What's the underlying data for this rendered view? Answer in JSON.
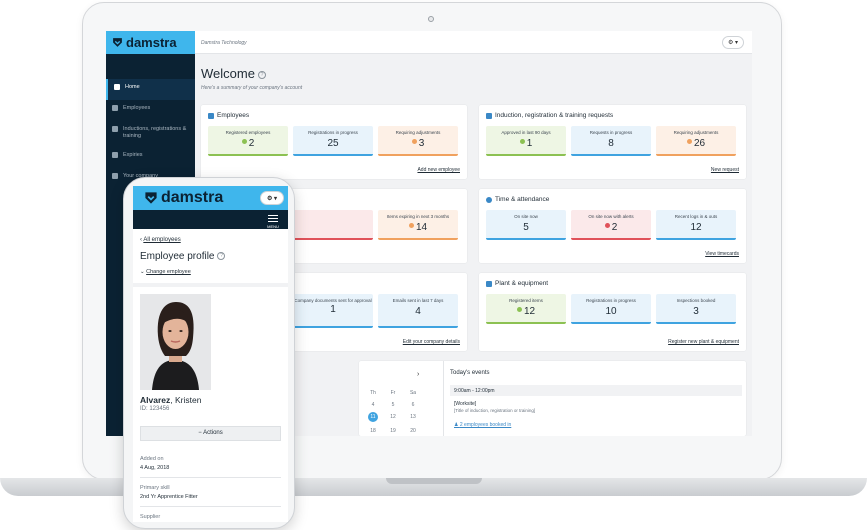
{
  "app": {
    "brand": "damstra",
    "org_name": "Damstra Technology",
    "settings_label": "⚙ ▾"
  },
  "sidebar": {
    "items": [
      {
        "label": "Home",
        "icon": "home-icon"
      },
      {
        "label": "Employees",
        "icon": "user-icon"
      },
      {
        "label": "Inductions, registrations & training",
        "icon": "clipboard-icon"
      },
      {
        "label": "Expiries",
        "icon": "calendar-icon"
      },
      {
        "label": "Your company",
        "icon": "group-icon"
      }
    ]
  },
  "main": {
    "welcome": "Welcome",
    "welcome_sub": "Here's a summary of your company's account",
    "employees": {
      "title": "Employees",
      "tiles": [
        {
          "label": "Registered employees",
          "value": "2",
          "dot": "#8cc152"
        },
        {
          "label": "Registrations in progress",
          "value": "25"
        },
        {
          "label": "Requiring adjustments",
          "value": "3",
          "dot": "#f0a15e"
        }
      ],
      "link": "Add new employee"
    },
    "induction": {
      "title": "Induction, registration & training requests",
      "tiles": [
        {
          "label": "Approved in last 90 days",
          "value": "1",
          "dot": "#8cc152"
        },
        {
          "label": "Requests in progress",
          "value": "8"
        },
        {
          "label": "Requiring adjustments",
          "value": "26",
          "dot": "#f0a15e"
        }
      ],
      "link": "New request"
    },
    "expiries": {
      "tiles": [
        {
          "label": "Items expiring in next 3 months",
          "value": "14",
          "dot": "#f0a15e"
        }
      ]
    },
    "time": {
      "title": "Time & attendance",
      "tiles": [
        {
          "label": "On site now",
          "value": "5"
        },
        {
          "label": "On site now with alerts",
          "value": "2",
          "dot": "#e0525a"
        },
        {
          "label": "Recent logs in & outs",
          "value": "12"
        }
      ],
      "link": "View timecards"
    },
    "company": {
      "tiles": [
        {
          "label": "Company documents sent for approval",
          "value": "1"
        },
        {
          "label": "Emails sent in last 7 days",
          "value": "4"
        }
      ],
      "link": "Edit your company details"
    },
    "plant": {
      "title": "Plant & equipment",
      "tiles": [
        {
          "label": "Registered items",
          "value": "12",
          "dot": "#8cc152"
        },
        {
          "label": "Registrations in progress",
          "value": "10"
        },
        {
          "label": "Inspections booked",
          "value": "3"
        }
      ],
      "link": "Register new plant & equipment"
    },
    "calendar": {
      "next": "›",
      "days": [
        "Th",
        "Fr",
        "Sa",
        "4",
        "5",
        "6",
        "11",
        "12",
        "13",
        "18",
        "19",
        "20"
      ],
      "today": "11"
    },
    "events": {
      "title": "Today's events",
      "slot": "9:00am - 12:00pm",
      "name": "[Worksite]",
      "desc": "[Title of induction, registration or training]",
      "link": "2 employees booked in"
    }
  },
  "phone": {
    "brand": "damstra",
    "menu_label": "MENU",
    "back": "All employees",
    "title": "Employee profile",
    "change": "Change employee",
    "last_name": "Alvarez",
    "first_name": ", Kristen",
    "id": "ID: 123456",
    "actions": "− Actions",
    "added_label": "Added on",
    "added_value": "4 Aug, 2018",
    "skill_label": "Primary skill",
    "skill_value": "2nd Yr Apprentice Fitter",
    "next_label": "Supplier"
  }
}
